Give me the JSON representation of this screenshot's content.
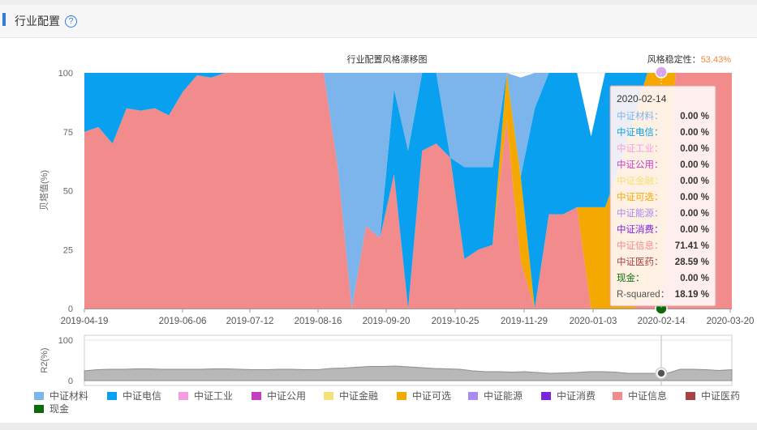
{
  "header": {
    "title": "行业配置",
    "help_icon": "question-circle-icon"
  },
  "chart_data": {
    "type": "area",
    "title": "行业配置风格漂移图",
    "stability_label": "风格稳定性：",
    "stability_value": "53.43%",
    "ylabel": "贝塔值(%)",
    "ylim": [
      0,
      100
    ],
    "yticks": [
      "100",
      "75",
      "50",
      "25",
      "0"
    ],
    "xtick_labels": [
      "2019-04-19",
      "2019-06-06",
      "2019-07-12",
      "2019-08-16",
      "2019-09-20",
      "2019-10-25",
      "2019-11-29",
      "2020-01-03",
      "2020-02-14",
      "2020-03-20"
    ],
    "n_points": 47,
    "series": [
      {
        "name": "中证材料",
        "color": "#7cb5ec",
        "values": [
          0,
          0,
          0,
          0,
          0,
          0,
          0,
          0,
          0,
          0,
          0,
          0,
          0,
          0,
          0,
          0,
          0,
          0,
          40,
          100,
          65,
          70,
          7,
          33,
          33,
          34,
          36,
          40,
          40,
          40,
          40,
          42,
          15,
          0,
          0,
          0,
          0,
          0,
          0,
          0,
          0,
          0,
          0,
          0,
          0,
          0,
          0
        ]
      },
      {
        "name": "中证电信",
        "color": "#0aa0f0",
        "values": [
          25,
          23,
          30,
          15,
          16,
          15,
          18,
          8,
          1,
          2,
          0,
          0,
          0,
          0,
          0,
          0,
          0,
          0,
          0,
          0,
          0,
          0,
          36,
          67,
          33,
          30,
          0,
          39,
          35,
          33,
          0,
          0,
          85,
          60,
          60,
          57,
          30,
          57,
          40,
          20,
          0,
          0,
          0,
          0,
          0,
          0,
          0
        ]
      },
      {
        "name": "中证工业",
        "color": "#f59de0",
        "values": [
          0,
          0,
          0,
          0,
          0,
          0,
          0,
          0,
          0,
          0,
          0,
          0,
          0,
          0,
          0,
          0,
          0,
          0,
          0,
          0,
          0,
          0,
          0,
          0,
          0,
          0,
          0,
          0,
          0,
          0,
          0,
          0,
          0,
          0,
          0,
          0,
          0,
          0,
          0,
          0,
          0,
          0,
          0,
          0,
          0,
          0,
          0
        ]
      },
      {
        "name": "中证公用",
        "color": "#c23fc2",
        "values": [
          0,
          0,
          0,
          0,
          0,
          0,
          0,
          0,
          0,
          0,
          0,
          0,
          0,
          0,
          0,
          0,
          0,
          0,
          0,
          0,
          0,
          0,
          0,
          0,
          0,
          0,
          0,
          0,
          0,
          0,
          0,
          0,
          0,
          0,
          0,
          0,
          0,
          0,
          0,
          0,
          0,
          0,
          0,
          0,
          0,
          0,
          0
        ]
      },
      {
        "name": "中证金融",
        "color": "#f4e177",
        "values": [
          0,
          0,
          0,
          0,
          0,
          0,
          0,
          0,
          0,
          0,
          0,
          0,
          0,
          0,
          0,
          0,
          0,
          0,
          0,
          0,
          0,
          0,
          0,
          0,
          0,
          0,
          0,
          0,
          0,
          0,
          0,
          0,
          0,
          0,
          0,
          0,
          0,
          0,
          0,
          0,
          0,
          0,
          0,
          0,
          0,
          0,
          0
        ]
      },
      {
        "name": "中证可选",
        "color": "#f5a800",
        "values": [
          0,
          0,
          0,
          0,
          0,
          0,
          0,
          0,
          0,
          0,
          0,
          0,
          0,
          0,
          0,
          0,
          0,
          0,
          0,
          0,
          0,
          0,
          0,
          0,
          0,
          0,
          0,
          0,
          0,
          0,
          20,
          36,
          0,
          0,
          0,
          0,
          43,
          43,
          60,
          80,
          96,
          100,
          0,
          0,
          0,
          0,
          0
        ]
      },
      {
        "name": "中证能源",
        "color": "#a98af0",
        "values": [
          0,
          0,
          0,
          0,
          0,
          0,
          0,
          0,
          0,
          0,
          0,
          0,
          0,
          0,
          0,
          0,
          0,
          0,
          0,
          0,
          0,
          0,
          0,
          0,
          0,
          0,
          0,
          0,
          0,
          0,
          0,
          0,
          0,
          0,
          0,
          0,
          0,
          0,
          0,
          0,
          0,
          0,
          0,
          0,
          0,
          0,
          0
        ]
      },
      {
        "name": "中证消费",
        "color": "#7a24e0",
        "values": [
          0,
          0,
          0,
          0,
          0,
          0,
          0,
          0,
          0,
          0,
          0,
          0,
          0,
          0,
          0,
          0,
          0,
          0,
          0,
          0,
          0,
          0,
          0,
          0,
          0,
          0,
          0,
          0,
          0,
          0,
          0,
          0,
          0,
          0,
          0,
          0,
          0,
          0,
          0,
          0,
          0,
          0,
          0,
          0,
          0,
          0,
          0
        ]
      },
      {
        "name": "中证信息",
        "color": "#f28b8b",
        "values": [
          75,
          77,
          70,
          85,
          84,
          85,
          82,
          92,
          99,
          98,
          100,
          100,
          100,
          100,
          100,
          100,
          100,
          100,
          60,
          0,
          35,
          30,
          57,
          0,
          67,
          70,
          64,
          21,
          25,
          27,
          80,
          20,
          0,
          40,
          40,
          43,
          0,
          0,
          0,
          0,
          4,
          0,
          100,
          100,
          100,
          100,
          100
        ]
      },
      {
        "name": "中证医药",
        "color": "#a84242",
        "values": [
          0,
          0,
          0,
          0,
          0,
          0,
          0,
          0,
          0,
          0,
          0,
          0,
          0,
          0,
          0,
          0,
          0,
          0,
          0,
          0,
          0,
          0,
          0,
          0,
          0,
          0,
          0,
          0,
          0,
          0,
          0,
          0,
          0,
          0,
          0,
          0,
          0,
          0,
          0,
          0,
          0,
          0,
          0,
          0,
          0,
          0,
          0
        ]
      },
      {
        "name": "现金",
        "color": "#0b6b0b",
        "values": [
          0,
          0,
          0,
          0,
          0,
          0,
          0,
          0,
          0,
          0,
          0,
          0,
          0,
          0,
          0,
          0,
          0,
          0,
          0,
          0,
          0,
          0,
          0,
          0,
          0,
          0,
          0,
          0,
          0,
          0,
          0,
          0,
          0,
          0,
          0,
          0,
          0,
          0,
          0,
          0,
          0,
          0,
          0,
          0,
          0,
          0,
          0
        ]
      }
    ],
    "r2": {
      "ylabel": "R2(%)",
      "ylim": [
        0,
        100
      ],
      "yticks": [
        "100",
        "0"
      ],
      "values": [
        24,
        27,
        28,
        28,
        29,
        29,
        28,
        28,
        28,
        28,
        29,
        29,
        28,
        27,
        27,
        28,
        28,
        27,
        27,
        30,
        31,
        33,
        35,
        35,
        36,
        34,
        32,
        30,
        29,
        28,
        24,
        22,
        22,
        21,
        22,
        20,
        18,
        19,
        20,
        22,
        22,
        21,
        18,
        18,
        18,
        18,
        28,
        28,
        27,
        25,
        27
      ]
    },
    "tooltip": {
      "date": "2020-02-14",
      "rows": [
        {
          "name": "中证材料",
          "sep": "：",
          "value": "0.00 %",
          "color": "#7cb5ec"
        },
        {
          "name": "中证电信",
          "sep": "：",
          "value": "0.00 %",
          "color": "#0aa0f0"
        },
        {
          "name": "中证工业",
          "sep": "：",
          "value": "0.00 %",
          "color": "#f59de0"
        },
        {
          "name": "中证公用",
          "sep": "：",
          "value": "0.00 %",
          "color": "#c23fc2"
        },
        {
          "name": "中证金融",
          "sep": "：",
          "value": "0.00 %",
          "color": "#f4e177"
        },
        {
          "name": "中证可选",
          "sep": "：",
          "value": "0.00 %",
          "color": "#f5a800"
        },
        {
          "name": "中证能源",
          "sep": "：",
          "value": "0.00 %",
          "color": "#a98af0"
        },
        {
          "name": "中证消费",
          "sep": "：",
          "value": "0.00 %",
          "color": "#7a24e0"
        },
        {
          "name": "中证信息",
          "sep": "：",
          "value": "71.41 %",
          "color": "#f28b8b"
        },
        {
          "name": "中证医药",
          "sep": "：",
          "value": "28.59 %",
          "color": "#a84242"
        },
        {
          "name": "现金",
          "sep": "：",
          "value": "0.00 %",
          "color": "#0b6b0b"
        },
        {
          "name": "R-squared",
          "sep": "：",
          "value": "18.19 %",
          "color": "#555555"
        }
      ]
    },
    "legend_position": "bottom",
    "grid": true
  }
}
